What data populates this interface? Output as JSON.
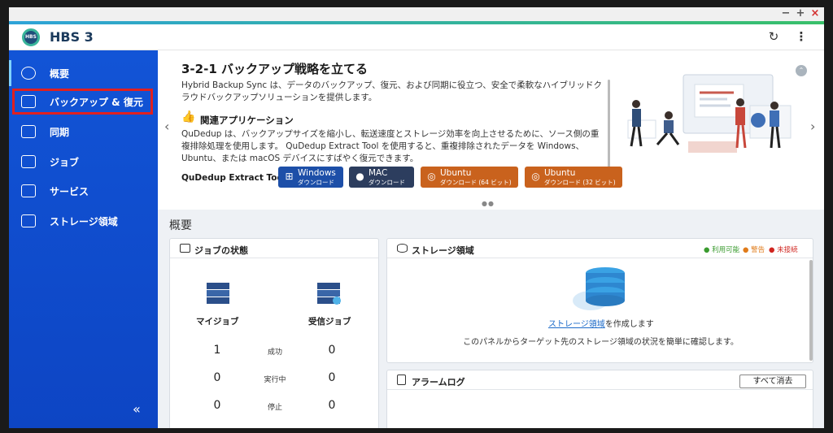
{
  "app": {
    "title": "HBS 3",
    "logo_text": "HBS"
  },
  "window": {
    "minimize_glyph": "−",
    "maximize_glyph": "+",
    "close_glyph": "×"
  },
  "header": {
    "refresh_glyph": "↻",
    "more_glyph": "⋮"
  },
  "sidebar": {
    "items": [
      {
        "label": "概要",
        "icon": "gauge-icon"
      },
      {
        "label": "バックアップ & 復元",
        "icon": "backup-icon",
        "highlighted": true
      },
      {
        "label": "同期",
        "icon": "sync-icon"
      },
      {
        "label": "ジョブ",
        "icon": "job-icon"
      },
      {
        "label": "サービス",
        "icon": "services-icon"
      },
      {
        "label": "ストレージ領域",
        "icon": "storage-space-icon"
      }
    ],
    "collapse_glyph": "«"
  },
  "banner": {
    "title": "3-2-1 バックアップ戦略を立てる",
    "description": "Hybrid Backup Sync は、データのバックアップ、復元、および同期に役立つ、安全で柔軟なハイブリッドクラウドバックアップソリューションを提供します。",
    "related_title": "関連アプリケーション",
    "related_description": "QuDedup は、バックアップサイズを縮小し、転送速度とストレージ効率を向上させるために、ソース側の重複排除処理を使用します。 QuDedup Extract Tool を使用すると、重複排除されたデータを Windows、Ubuntu、または macOS デバイスにすばやく復元できます。",
    "tool_label": "QuDedup Extract Tool:",
    "downloads": [
      {
        "title": "Windows",
        "sub": "ダウンロード"
      },
      {
        "title": "MAC",
        "sub": "ダウンロード"
      },
      {
        "title": "Ubuntu",
        "sub": "ダウンロード (64 ビット)"
      },
      {
        "title": "Ubuntu",
        "sub": "ダウンロード (32 ビット)"
      }
    ],
    "dots": "●●",
    "prev_glyph": "‹",
    "next_glyph": "›",
    "collapse_glyph": "⌃"
  },
  "overview": {
    "title": "概要",
    "job_status": {
      "title": "ジョブの状態",
      "my_jobs_label": "マイジョブ",
      "incoming_jobs_label": "受信ジョブ",
      "rows": [
        {
          "state": "成功",
          "my": "1",
          "incoming": "0"
        },
        {
          "state": "実行中",
          "my": "0",
          "incoming": "0"
        },
        {
          "state": "停止",
          "my": "0",
          "incoming": "0"
        }
      ]
    },
    "storage": {
      "title": "ストレージ領域",
      "legend": [
        {
          "label": "利用可能",
          "color": "#3a9b2f"
        },
        {
          "label": "警告",
          "color": "#e07b1a"
        },
        {
          "label": "未接続",
          "color": "#d0251f"
        }
      ],
      "create_link": "ストレージ領域",
      "create_suffix": "を作成します",
      "description": "このパネルからターゲット先のストレージ領域の状況を簡単に確認します。"
    },
    "alarm_log": {
      "title": "アラームログ",
      "clear_all_label": "すべて消去"
    }
  },
  "colors": {
    "sidebar_bg": "#1254d6",
    "highlight_outline": "#e02020",
    "accent": "#2ea3d8",
    "ubuntu_button": "#c9621d",
    "windows_button": "#1d4fa8"
  }
}
